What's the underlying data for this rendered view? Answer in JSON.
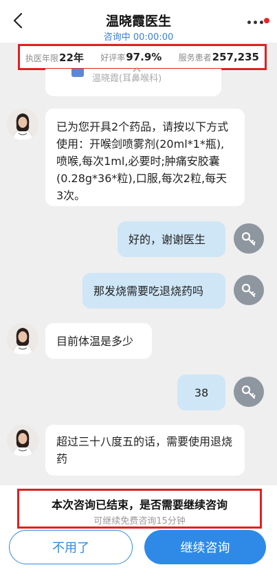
{
  "header": {
    "title": "温晓霞医生",
    "status": "咨询中 00:00:00"
  },
  "stats": [
    {
      "label": "执医年限",
      "value": "22年"
    },
    {
      "label": "好评率",
      "value": "97.9%"
    },
    {
      "label": "服务患者",
      "value": "257,235"
    }
  ],
  "quote_card": {
    "text": "温晓霞(耳鼻喉科)"
  },
  "messages": [
    {
      "sender": "doctor",
      "text": "已为您开具2个药品，请按以下方式使用：开喉剑喷雾剂(20ml*1*瓶),喷喉,每次1ml,必要时;肿痛安胶囊(0.28g*36*粒),口服,每次2粒,每天3次。"
    },
    {
      "sender": "user",
      "text": "好的，谢谢医生"
    },
    {
      "sender": "user",
      "text": "那发烧需要吃退烧药吗"
    },
    {
      "sender": "doctor",
      "text": "目前体温是多少"
    },
    {
      "sender": "user",
      "text": "38"
    },
    {
      "sender": "doctor",
      "text": "超过三十八度五的话，需要使用退烧药"
    }
  ],
  "end_prompt": {
    "title": "本次咨询已结束，是否需要继续咨询",
    "subtitle": "可继续免费咨询15分钟"
  },
  "buttons": {
    "decline": "不用了",
    "continue": "继续咨询"
  },
  "colors": {
    "accent": "#2e8ae6",
    "highlight_border": "#e11f1f",
    "user_bubble": "#cfe6f7",
    "notification_dot": "#e8262a"
  }
}
